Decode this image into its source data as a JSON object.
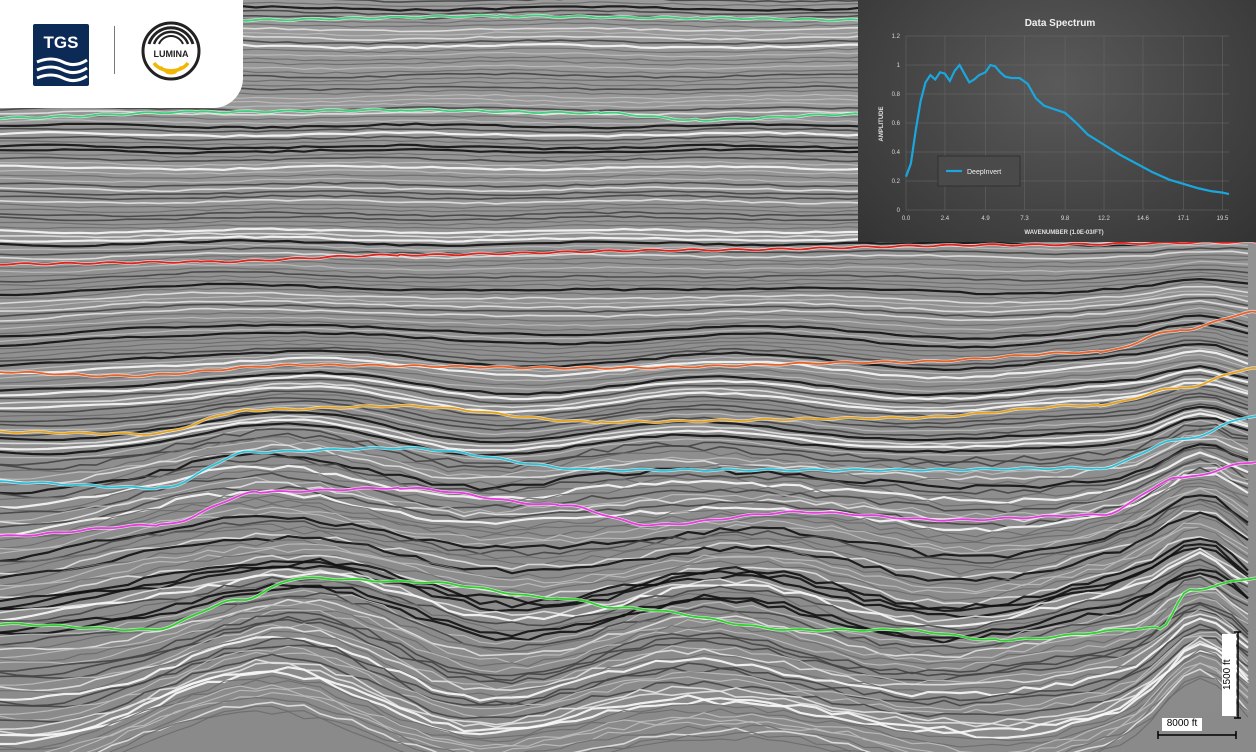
{
  "logos": {
    "tgs_text": "TGS",
    "lumina_text": "LUMINA",
    "tgs_color": "#0c2a56",
    "lumina_ring_color": "#222222",
    "lumina_accent_color": "#f2b705"
  },
  "scale_bar": {
    "vertical_label": "1500 ft",
    "horizontal_label": "8000 ft"
  },
  "horizon_colors": [
    "#3fd07a",
    "#3fd07a",
    "#e0231b",
    "#e8622a",
    "#e8a21a",
    "#2cc1d8",
    "#e83ce0",
    "#2bd42b"
  ],
  "chart_data": {
    "type": "line",
    "title": "Data Spectrum",
    "xlabel": "WAVENUMBER (1.0E-03/FT)",
    "ylabel": "AMPLITUDE",
    "xlim": [
      0,
      19.9
    ],
    "ylim": [
      0,
      1.2
    ],
    "xticks": [
      "0.0",
      "2.4",
      "4.9",
      "7.3",
      "9.8",
      "12.2",
      "14.6",
      "17.1",
      "19.5"
    ],
    "xtick_values": [
      0.0,
      2.4,
      4.9,
      7.3,
      9.8,
      12.2,
      14.6,
      17.1,
      19.5
    ],
    "yticks": [
      "0",
      "0.2",
      "0.4",
      "0.6",
      "0.8",
      "1",
      "1.2"
    ],
    "ytick_values": [
      0,
      0.2,
      0.4,
      0.6,
      0.8,
      1.0,
      1.2
    ],
    "grid": true,
    "legend_position": "left",
    "series": [
      {
        "name": "DeepInvert",
        "color": "#1aa7e0",
        "x": [
          0.0,
          0.3,
          0.6,
          0.9,
          1.2,
          1.5,
          1.8,
          2.1,
          2.4,
          2.7,
          3.0,
          3.3,
          3.6,
          3.9,
          4.2,
          4.5,
          4.9,
          5.2,
          5.5,
          5.8,
          6.1,
          6.5,
          7.0,
          7.5,
          8.0,
          8.5,
          9.0,
          9.8,
          10.5,
          11.2,
          12.2,
          13.2,
          14.2,
          15.2,
          16.2,
          17.1,
          18.0,
          18.8,
          19.5,
          19.9
        ],
        "values": [
          0.23,
          0.32,
          0.55,
          0.75,
          0.88,
          0.93,
          0.9,
          0.95,
          0.94,
          0.89,
          0.96,
          1.0,
          0.94,
          0.88,
          0.9,
          0.93,
          0.95,
          1.0,
          0.99,
          0.95,
          0.92,
          0.91,
          0.91,
          0.87,
          0.77,
          0.72,
          0.7,
          0.67,
          0.6,
          0.52,
          0.45,
          0.38,
          0.32,
          0.26,
          0.21,
          0.18,
          0.15,
          0.13,
          0.12,
          0.11
        ]
      }
    ]
  }
}
